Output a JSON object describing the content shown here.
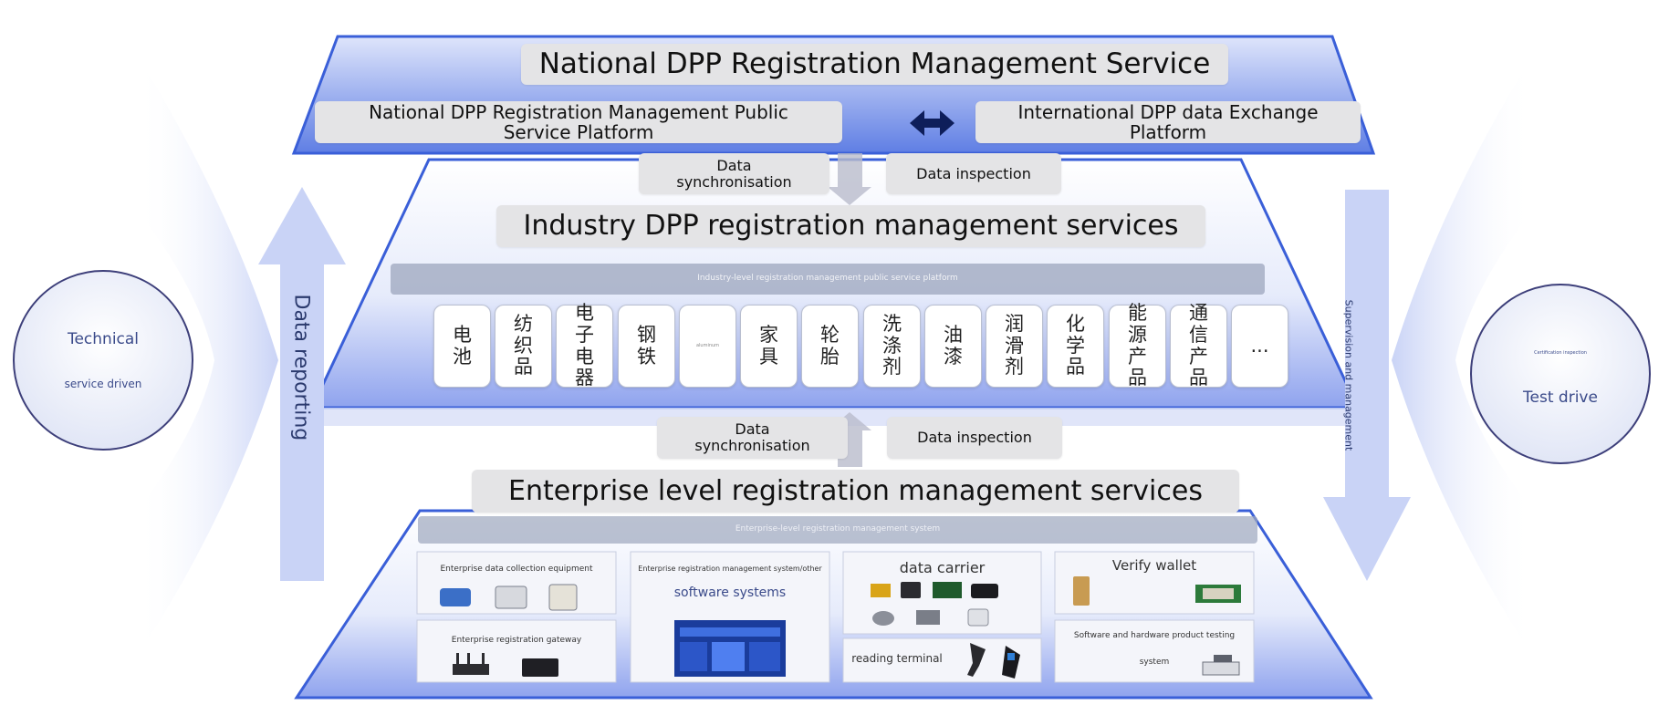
{
  "colors": {
    "tier_border": "#3a5fd8",
    "arrow_fill": "#c9d3f6",
    "banner_bg": "#e4e4e6",
    "circle_text": "#3a4a8a"
  },
  "top_tier": {
    "title": "National DPP Registration Management Service",
    "public_platform": "National DPP Registration Management Public Service Platform",
    "exchange_platform": "International DPP data Exchange Platform",
    "exchange_icon": "double-arrow-icon"
  },
  "upper_links": {
    "sync": "Data synchronisation",
    "inspect": "Data inspection"
  },
  "middle_tier": {
    "title": "Industry DPP registration management services",
    "platform_label": "Industry-level registration management public service platform",
    "industries": [
      "电池",
      "纺织品",
      "电子电器",
      "钢铁",
      "aluminum",
      "家具",
      "轮胎",
      "洗涤剂",
      "油漆",
      "润滑剂",
      "化学品",
      "能源产品",
      "通信产品",
      "..."
    ]
  },
  "lower_links": {
    "sync": "Data synchronisation",
    "inspect": "Data inspection"
  },
  "bottom_tier": {
    "title": "Enterprise level registration management services",
    "system_label": "Enterprise-level registration management system",
    "collection_equipment": "Enterprise data collection equipment",
    "registration_gateway": "Enterprise registration gateway",
    "mgmt_system": "Enterprise registration management system/other",
    "software_systems": "software systems",
    "data_carrier": "data carrier",
    "reading_terminal": "reading terminal",
    "verify_wallet": "Verify wallet",
    "testing_line1": "Software and hardware product testing",
    "testing_line2": "system"
  },
  "left_side": {
    "circle_title": "Technical",
    "circle_sub": "service driven",
    "arrow_label": "Data reporting"
  },
  "right_side": {
    "circle_small": "Certification inspection",
    "circle_title": "Test drive",
    "arrow_label": "Supervision and management"
  }
}
